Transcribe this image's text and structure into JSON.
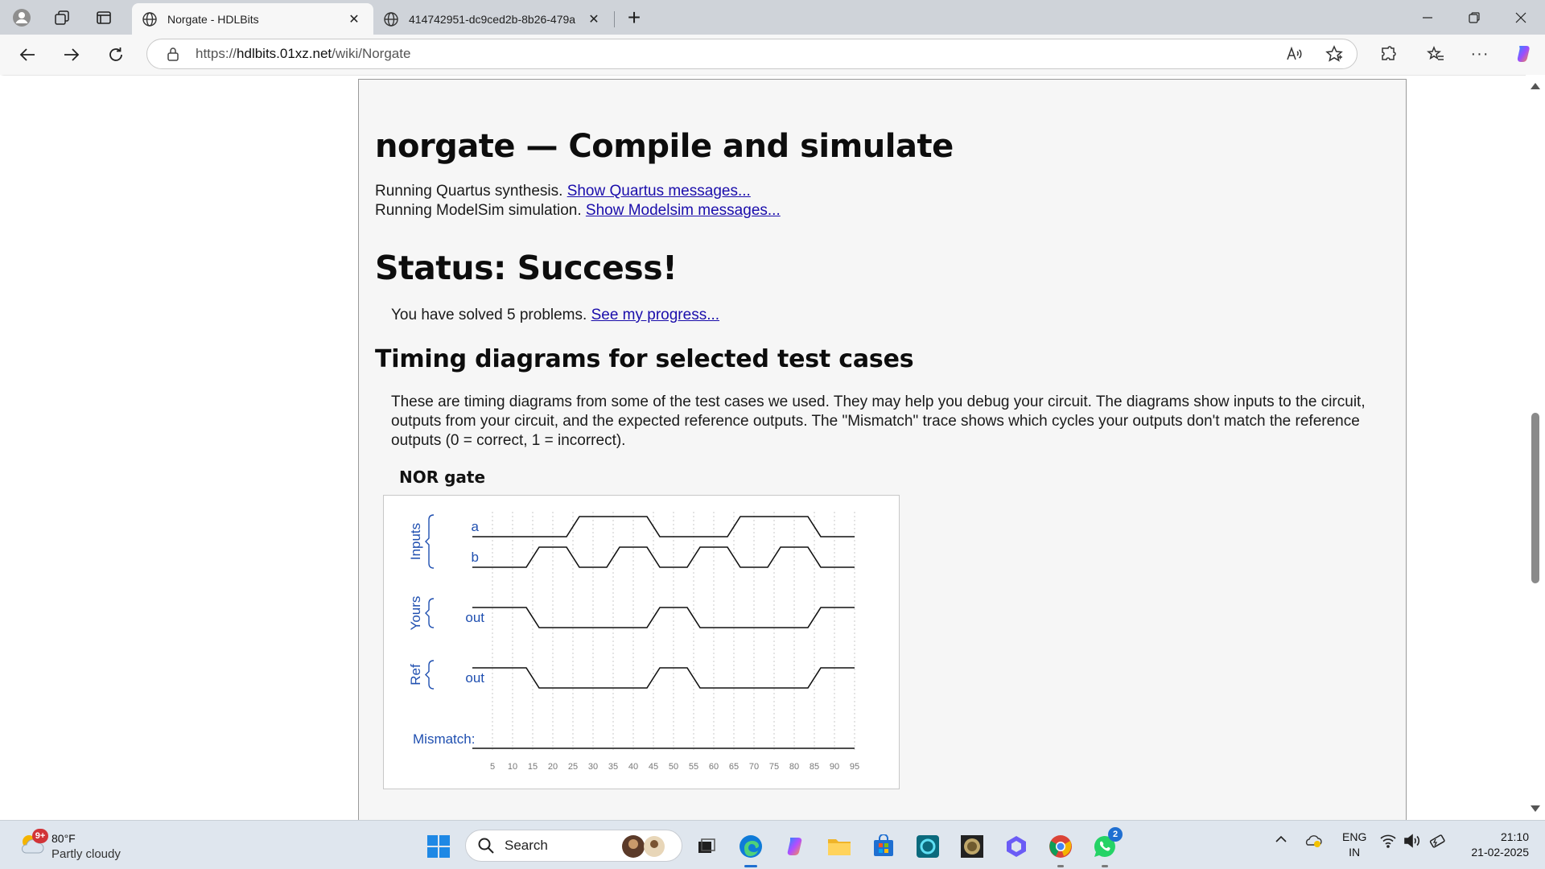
{
  "browser": {
    "tabs": [
      {
        "title": "Norgate - HDLBits",
        "active": true
      },
      {
        "title": "414742951-dc9ced2b-8b26-479a",
        "active": false
      }
    ],
    "new_tab_label": "+",
    "address": {
      "prefix": "https://",
      "host": "hdlbits.01xz.net",
      "path": "/wiki/Norgate"
    }
  },
  "page": {
    "title": "norgate — Compile and simulate",
    "quartus_line": "Running Quartus synthesis.",
    "quartus_link": "Show Quartus messages...",
    "modelsim_line": "Running ModelSim simulation.",
    "modelsim_link": "Show Modelsim messages...",
    "status": "Status: Success!",
    "solved_text": "You have solved 5 problems.",
    "progress_link": "See my progress...",
    "timing_heading": "Timing diagrams for selected test cases",
    "timing_description": "These are timing diagrams from some of the test cases we used. They may help you debug your circuit. The diagrams show inputs to the circuit, outputs from your circuit, and the expected reference outputs. The \"Mismatch\" trace shows which cycles your outputs don't match the reference outputs (0 = correct, 1 = incorrect).",
    "diagram_caption": "NOR gate"
  },
  "chart_data": {
    "type": "line",
    "title": "NOR gate",
    "group_labels": [
      "Inputs",
      "Yours",
      "Ref"
    ],
    "x_ticks": [
      5,
      10,
      15,
      20,
      25,
      30,
      35,
      40,
      45,
      50,
      55,
      60,
      65,
      70,
      75,
      80,
      85,
      90,
      95
    ],
    "xlim": [
      0,
      95
    ],
    "signal_color": "#1f4fb0",
    "series": [
      {
        "name": "a",
        "group": "Inputs",
        "transitions": [
          [
            0,
            0
          ],
          [
            25,
            1
          ],
          [
            45,
            0
          ],
          [
            65,
            1
          ],
          [
            85,
            0
          ]
        ]
      },
      {
        "name": "b",
        "group": "Inputs",
        "transitions": [
          [
            0,
            0
          ],
          [
            15,
            1
          ],
          [
            25,
            0
          ],
          [
            35,
            1
          ],
          [
            45,
            0
          ],
          [
            55,
            1
          ],
          [
            65,
            0
          ],
          [
            75,
            1
          ],
          [
            85,
            0
          ]
        ]
      },
      {
        "name": "out",
        "group": "Yours",
        "transitions": [
          [
            0,
            1
          ],
          [
            15,
            0
          ],
          [
            45,
            1
          ],
          [
            55,
            0
          ],
          [
            85,
            1
          ]
        ]
      },
      {
        "name": "out",
        "group": "Ref",
        "transitions": [
          [
            0,
            1
          ],
          [
            15,
            0
          ],
          [
            45,
            1
          ],
          [
            55,
            0
          ],
          [
            85,
            1
          ]
        ]
      },
      {
        "name": "Mismatch:",
        "group": "",
        "transitions": [
          [
            0,
            0
          ]
        ]
      }
    ]
  },
  "taskbar": {
    "weather_temp": "80°F",
    "weather_cond": "Partly cloudy",
    "weather_badge": "9+",
    "search_label": "Search",
    "whatsapp_badge": "2",
    "lang_top": "ENG",
    "lang_bottom": "IN",
    "time": "21:10",
    "date": "21-02-2025"
  },
  "colors": {
    "link": "#1a0dab",
    "page_bg": "#f6f6f6",
    "taskbar_bg": "#dfe6ee"
  }
}
